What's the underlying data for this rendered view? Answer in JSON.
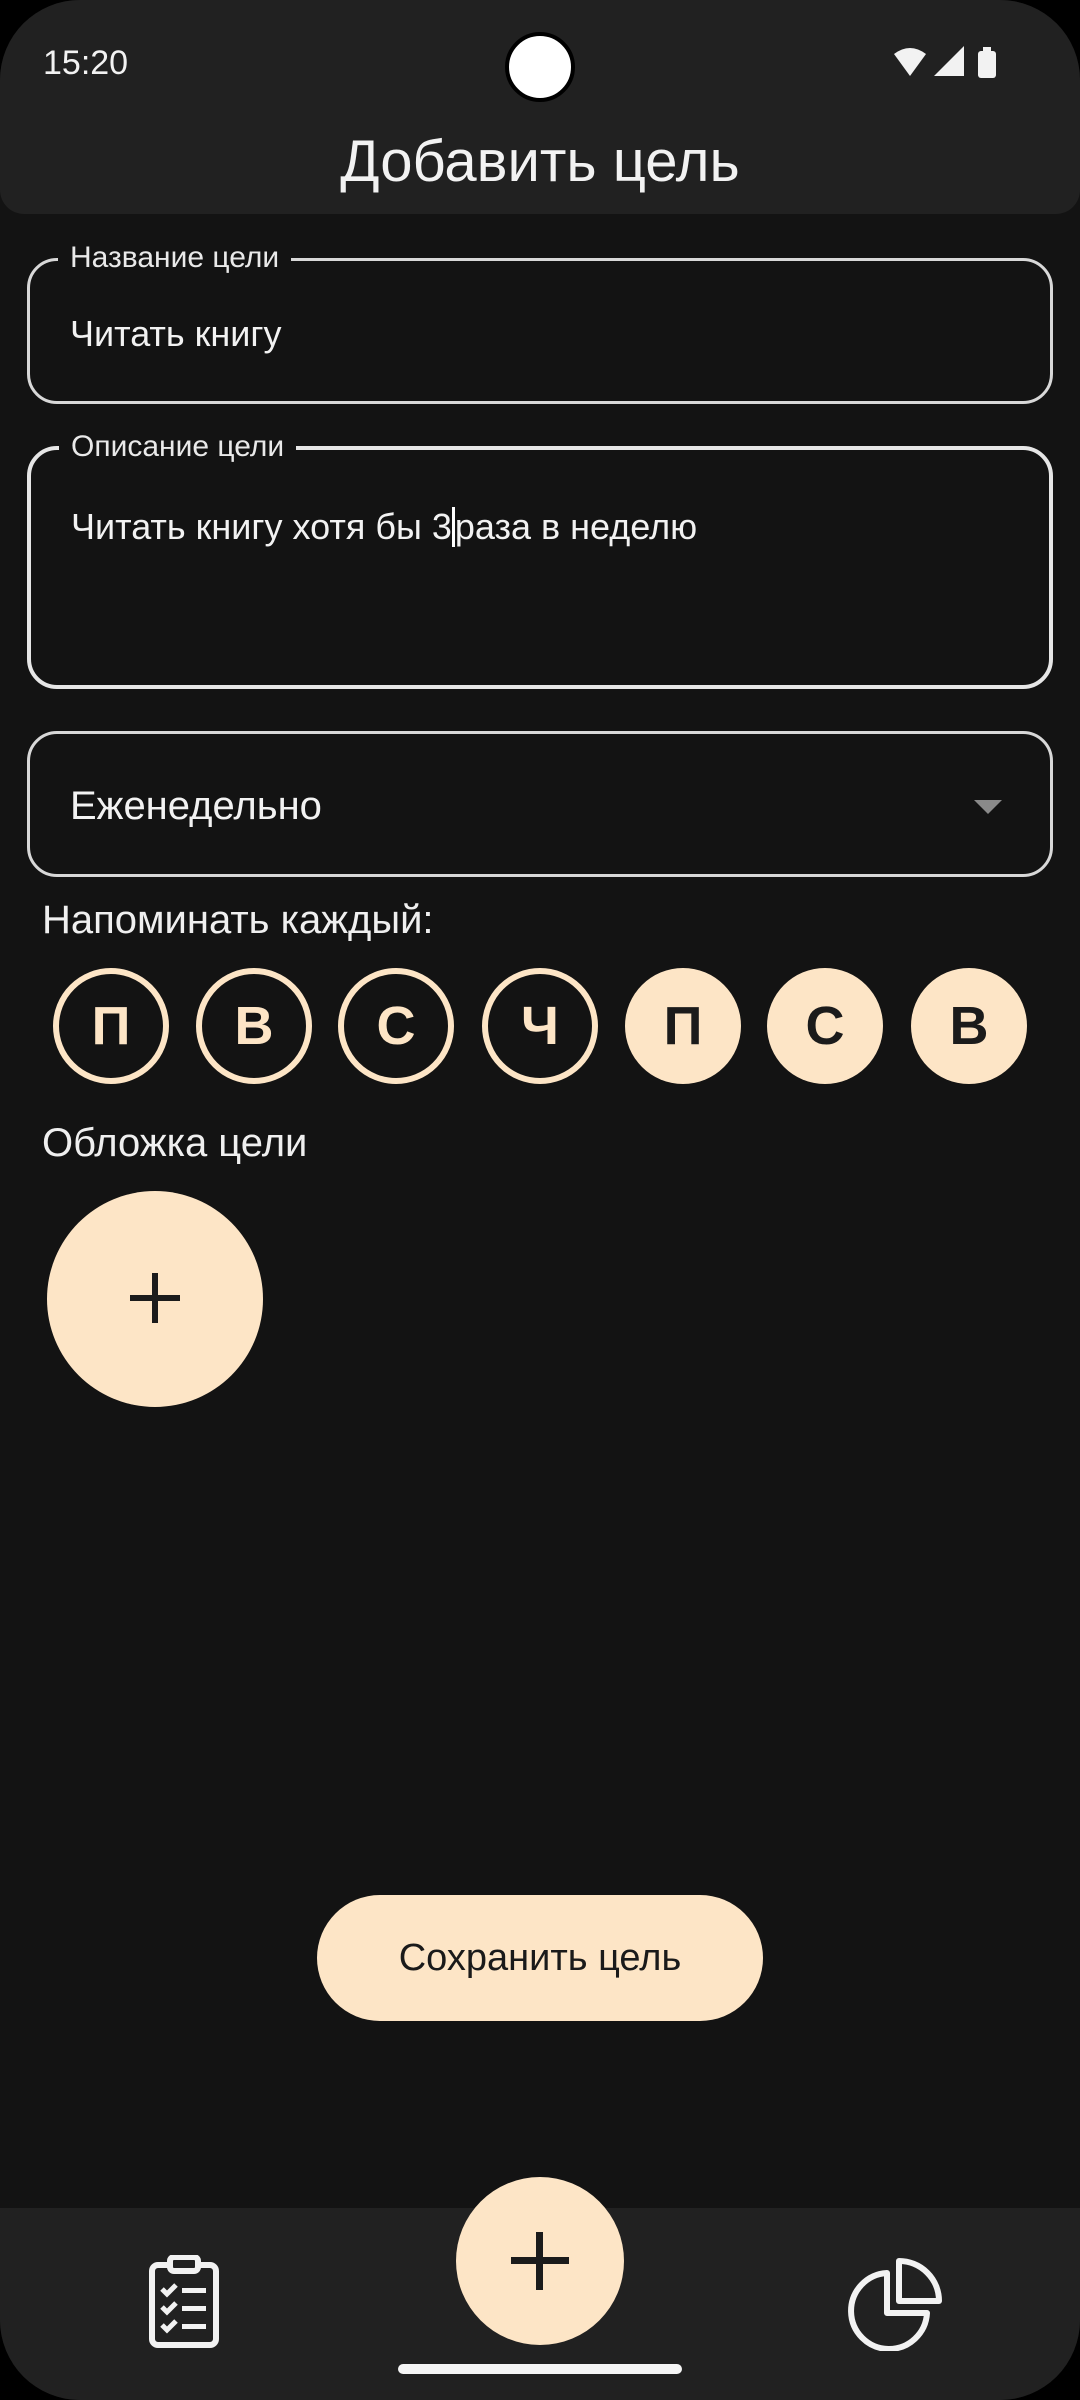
{
  "status_bar": {
    "time": "15:20",
    "icons": [
      "wifi-icon",
      "cellular-signal-icon",
      "battery-icon"
    ]
  },
  "header": {
    "title": "Добавить цель"
  },
  "form": {
    "name_field": {
      "label": "Название цели",
      "value": "Читать книгу"
    },
    "description_field": {
      "label": "Описание цели",
      "value_before_cursor": "Читать книгу хотя бы 3",
      "value_after_cursor": "раза в неделю"
    },
    "frequency_select": {
      "selected": "Еженедельно",
      "icon": "dropdown-arrow-icon"
    },
    "remind_label": "Напоминать каждый:",
    "days": [
      {
        "label": "П",
        "selected": false
      },
      {
        "label": "В",
        "selected": false
      },
      {
        "label": "С",
        "selected": false
      },
      {
        "label": "Ч",
        "selected": false
      },
      {
        "label": "П",
        "selected": true
      },
      {
        "label": "С",
        "selected": true
      },
      {
        "label": "В",
        "selected": true
      }
    ],
    "cover_label": "Обложка цели",
    "cover_add_icon": "plus-icon",
    "save_label": "Сохранить цель"
  },
  "bottom_nav": {
    "items": [
      "clipboard-checklist-icon",
      "plus-icon",
      "pie-chart-icon"
    ]
  },
  "colors": {
    "background": "#131313",
    "surface": "#212121",
    "accent": "#fde5c6",
    "text": "#f2f2f2"
  }
}
